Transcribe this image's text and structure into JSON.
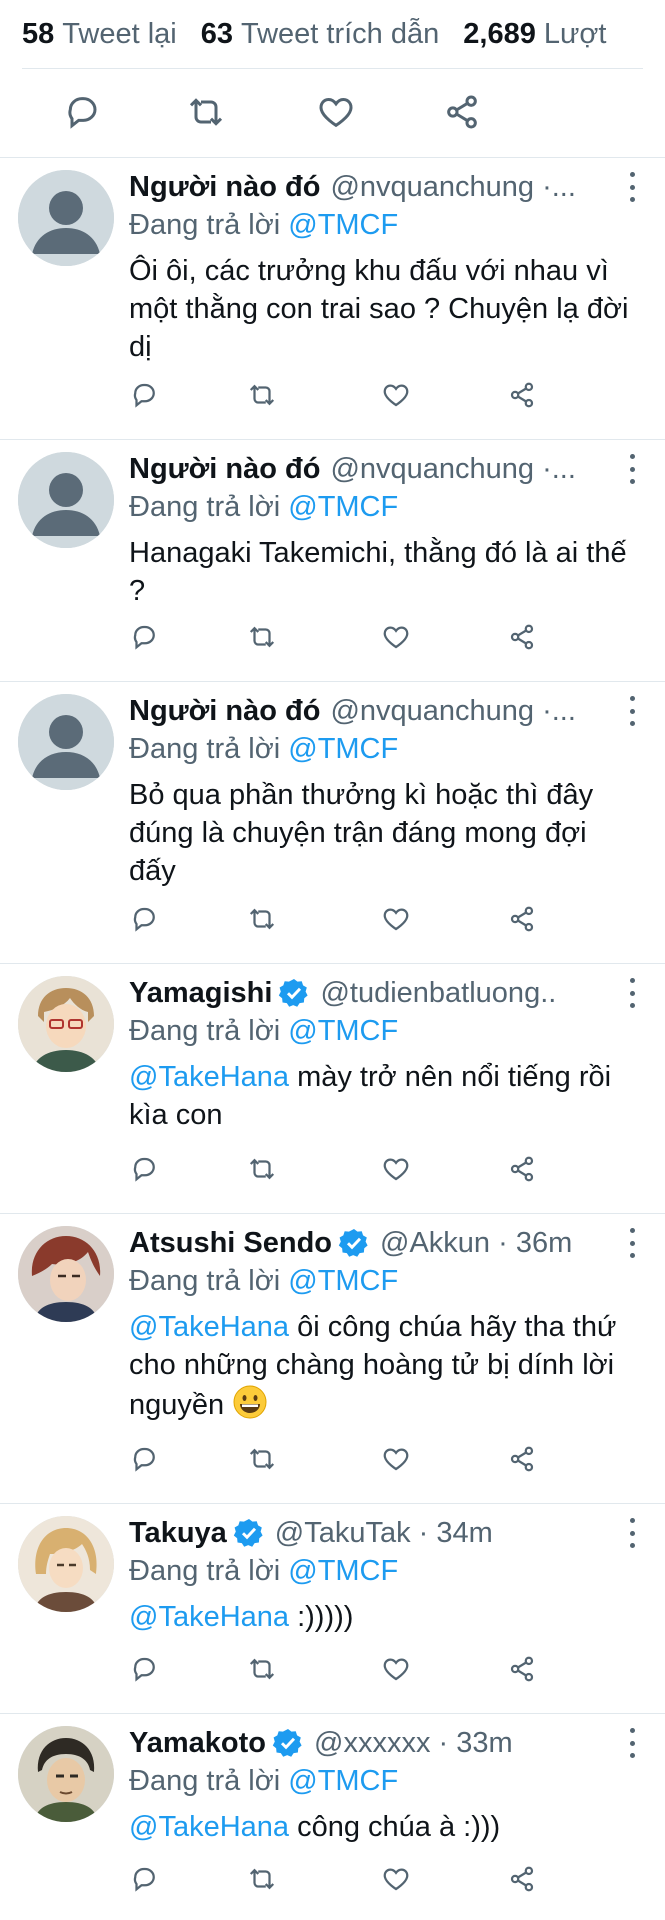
{
  "stats": [
    {
      "num": "58",
      "label": "Tweet lại"
    },
    {
      "num": "63",
      "label": "Tweet trích dẫn"
    },
    {
      "num": "2,689",
      "label": "Lượt"
    }
  ],
  "icons": {
    "reply": "reply-icon",
    "retweet": "retweet-icon",
    "like": "like-icon",
    "share": "share-icon",
    "more": "more-icon",
    "verified": "verified-badge-icon"
  },
  "colors": {
    "link": "#1d9bf0",
    "secondary": "#536471",
    "text": "#0f1419",
    "divider": "#e1e8ed"
  },
  "tweets": [
    {
      "name": "Người nào đó",
      "verified": false,
      "handle": "@nvquanchung ·...",
      "reply_prefix": "Đang trả lời ",
      "reply_to": "@TMCF",
      "mention": "",
      "text": "Ôi ôi, các trưởng khu đấu với nhau vì một thằng con trai sao ? Chuyện lạ đời dị",
      "avatar": "default"
    },
    {
      "name": "Người nào đó",
      "verified": false,
      "handle": "@nvquanchung ·...",
      "reply_prefix": "Đang trả lời ",
      "reply_to": "@TMCF",
      "mention": "",
      "text": "Hanagaki Takemichi, thằng đó là ai thế ?",
      "avatar": "default"
    },
    {
      "name": "Người nào đó",
      "verified": false,
      "handle": "@nvquanchung ·...",
      "reply_prefix": "Đang trả lời ",
      "reply_to": "@TMCF",
      "mention": "",
      "text": "Bỏ qua phần thưởng kì hoặc thì đây đúng là chuyện trận đáng mong đợi đấy",
      "avatar": "default"
    },
    {
      "name": "Yamagishi",
      "verified": true,
      "handle": "@tudienbatluong..",
      "reply_prefix": "Đang trả lời ",
      "reply_to": "@TMCF",
      "mention": "@TakeHana",
      "text": " mày trở nên nổi tiếng rồi kìa con",
      "avatar": "anime-yamagishi"
    },
    {
      "name": "Atsushi Sendo",
      "verified": true,
      "handle": "@Akkun · 36m",
      "reply_prefix": "Đang trả lời ",
      "reply_to": "@TMCF",
      "mention": "@TakeHana",
      "text": " ôi công chúa hãy tha thứ cho những chàng hoàng tử bị dính lời nguyền ",
      "emoji": "grinning-face-emoji",
      "avatar": "anime-sendo"
    },
    {
      "name": "Takuya",
      "verified": true,
      "handle": "@TakuTak · 34m",
      "reply_prefix": "Đang trả lời ",
      "reply_to": "@TMCF",
      "mention": "@TakeHana",
      "text": " :)))))",
      "avatar": "anime-takuya"
    },
    {
      "name": "Yamakoto",
      "verified": true,
      "handle": "@xxxxxx · 33m",
      "reply_prefix": "Đang trả lời ",
      "reply_to": "@TMCF",
      "mention": "@TakeHana",
      "text": " công chúa à :)))",
      "avatar": "anime-yamakoto"
    }
  ]
}
